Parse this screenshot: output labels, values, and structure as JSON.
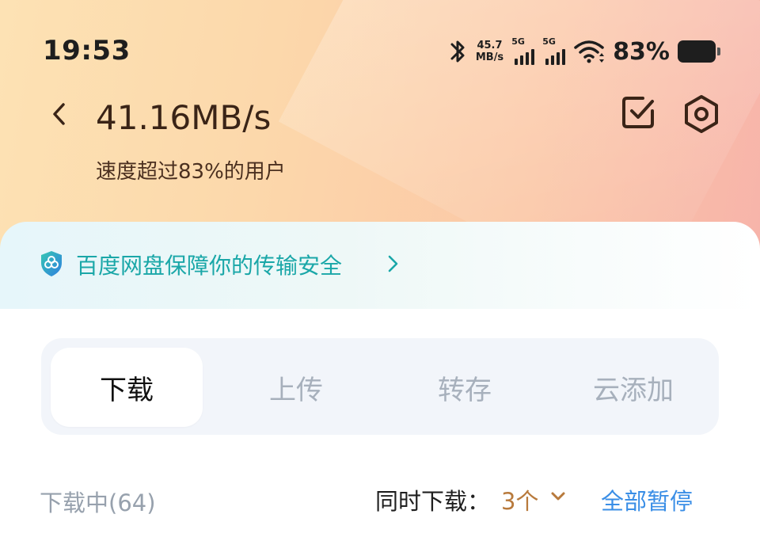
{
  "status_bar": {
    "time": "19:53",
    "net_speed_value": "45.7",
    "net_speed_unit": "MB/s",
    "sim1_type": "5G",
    "sim2_type": "5G",
    "battery_percent": "83%",
    "icons": [
      "bluetooth-icon",
      "signal-icon",
      "wifi-icon",
      "battery-icon"
    ]
  },
  "header": {
    "speed": "41.16MB/s",
    "speed_note": "速度超过83%的用户",
    "icons": [
      "back-icon",
      "multi-select-icon",
      "settings-icon"
    ]
  },
  "banner": {
    "text": "百度网盘保障你的传输安全",
    "icons": [
      "shield-icon",
      "chevron-right-icon"
    ]
  },
  "tabs": [
    {
      "label": "下载",
      "active": true
    },
    {
      "label": "上传",
      "active": false
    },
    {
      "label": "转存",
      "active": false
    },
    {
      "label": "云添加",
      "active": false
    }
  ],
  "list_header": {
    "downloading_label": "下载中(64)",
    "concurrent_label": "同时下载：",
    "concurrent_value": "3个",
    "pause_all_label": "全部暂停"
  },
  "colors": {
    "banner_text": "#1aa7a8",
    "accent_orange": "#b87a3c",
    "accent_blue": "#3a8ee6",
    "header_text": "#3a2417"
  }
}
